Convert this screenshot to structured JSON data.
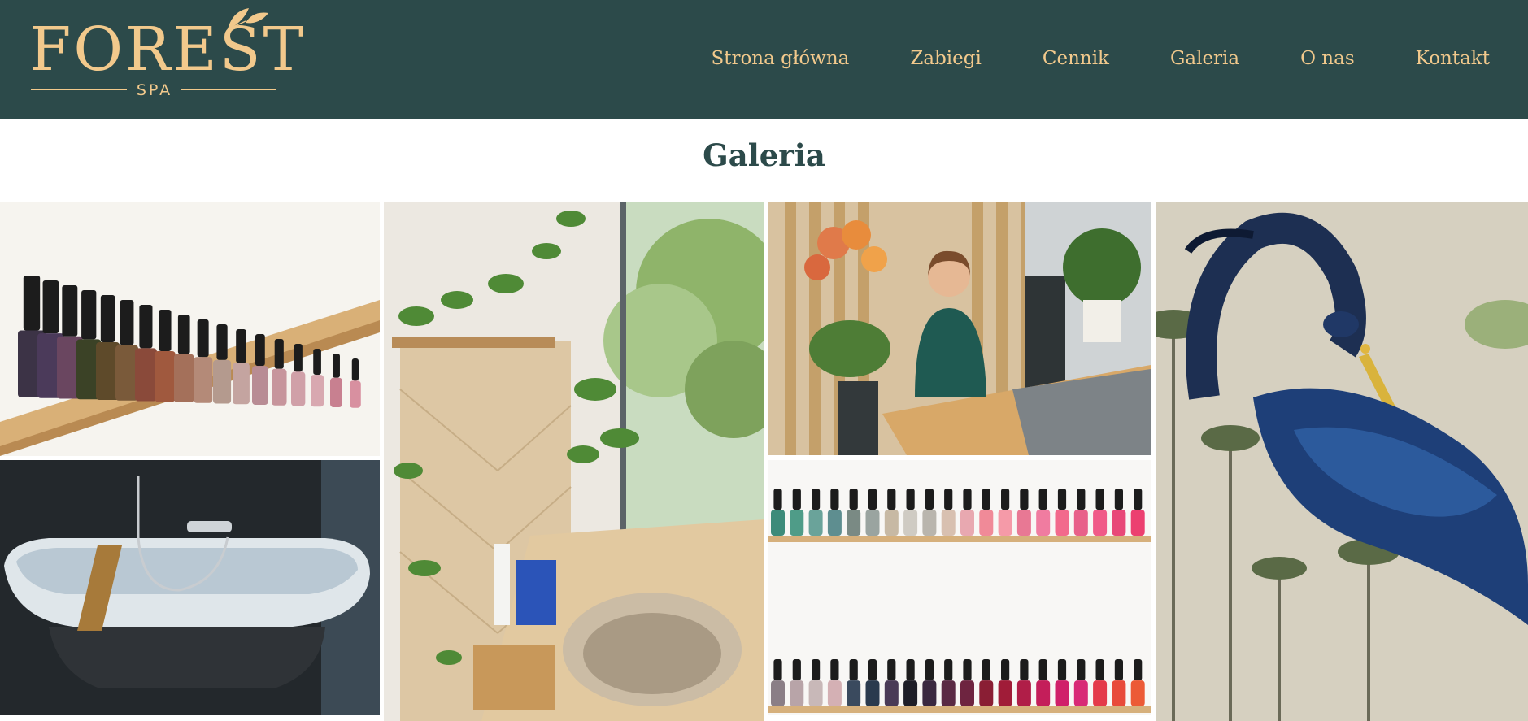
{
  "brand": {
    "name": "FOREST",
    "subtitle": "SPA",
    "primary_color": "#2c4a4a",
    "accent_color": "#f2c98c"
  },
  "nav": {
    "items": [
      {
        "label": "Strona główna"
      },
      {
        "label": "Zabiegi"
      },
      {
        "label": "Cennik"
      },
      {
        "label": "Galeria"
      },
      {
        "label": "O nas"
      },
      {
        "label": "Kontakt"
      }
    ]
  },
  "page": {
    "title": "Galeria"
  },
  "gallery": {
    "photos": [
      {
        "subject": "nail polish bottles on wooden shelf"
      },
      {
        "subject": "freestanding bathtub with wooden tray"
      },
      {
        "subject": "washbasin with plants and window"
      },
      {
        "subject": "receptionist at wooden desk with orchid"
      },
      {
        "subject": "two shelves of nail polish bottles"
      },
      {
        "subject": "heron wallpaper mural"
      }
    ]
  }
}
